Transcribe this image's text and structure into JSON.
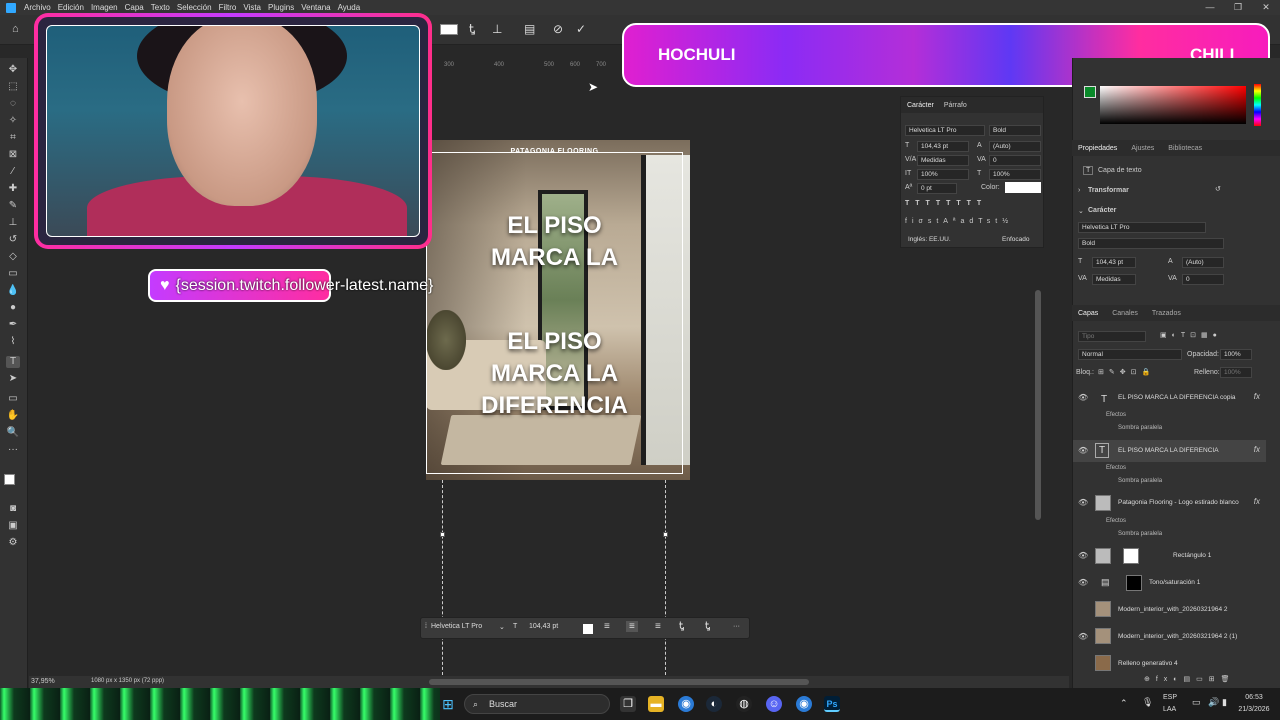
{
  "menubar": {
    "items": [
      "Archivo",
      "Edición",
      "Imagen",
      "Capa",
      "Texto",
      "Selección",
      "Filtro",
      "Vista",
      "Plugins",
      "Ventana",
      "Ayuda"
    ]
  },
  "window_controls": {
    "minimize": "—",
    "restore": "❐",
    "close": "✕"
  },
  "options_bar": {
    "home_icon": "home-icon",
    "cancel_icon": "cancel-icon",
    "commit_icon": "check-icon"
  },
  "ruler": {
    "ticks": [
      "300",
      "400",
      "500",
      "600",
      "700"
    ]
  },
  "banner": {
    "left": "HOCHULI",
    "right": "CHILL"
  },
  "follower": {
    "text": "{session.twitch.follower-latest.name}"
  },
  "document": {
    "brand": "PATAGONIA FLOORING",
    "text1_line1": "EL PISO",
    "text1_line2": "MARCA LA",
    "text2_line1": "EL PISO",
    "text2_line2": "MARCA LA",
    "text2_line3": "DIFERENCIA"
  },
  "character_panel": {
    "tab_character": "Carácter",
    "tab_paragraph": "Párrafo",
    "font_family": "Helvetica LT Pro",
    "font_style": "Bold",
    "font_size": "104,43 pt",
    "leading": "(Auto)",
    "kerning": "Medidas",
    "tracking": "0",
    "vertical_scale": "100%",
    "horizontal_scale": "100%",
    "baseline": "0 pt",
    "color_label": "Color:",
    "language": "Inglés: EE.UU.",
    "antialias": "Enfocado"
  },
  "properties": {
    "tabs": [
      "Propiedades",
      "Ajustes",
      "Bibliotecas"
    ],
    "layer_type": "Capa de texto",
    "transform_label": "Transformar",
    "character_label": "Carácter",
    "font_family": "Helvetica LT Pro",
    "font_style": "Bold",
    "font_size": "104,43 pt",
    "leading": "(Auto)",
    "kerning": "Medidas",
    "tracking": "0"
  },
  "layers_panel": {
    "tabs": [
      "Capas",
      "Canales",
      "Trazados"
    ],
    "search_placeholder": "Tipo",
    "blend_mode": "Normal",
    "opacity_label": "Opacidad:",
    "opacity": "100%",
    "lock_label": "Bloq.:",
    "fill_label": "Relleno:",
    "fill": "100%",
    "layers": [
      {
        "name": "EL PISO MARCA LA DIFERENCIA copia",
        "fx": "fx"
      },
      {
        "name": "EL PISO MARCA LA DIFERENCIA",
        "fx": "fx"
      },
      {
        "name": "Patagonia Flooring - Logo estirado blanco",
        "fx": "fx"
      },
      {
        "name": "Rectángulo 1",
        "fx": ""
      },
      {
        "name": "Tono/saturación 1",
        "fx": ""
      },
      {
        "name": "Modern_interior_with_20260321964 2",
        "fx": ""
      },
      {
        "name": "Modern_interior_with_20260321964 2 (1)",
        "fx": ""
      },
      {
        "name": "Relleno generativo 4",
        "fx": ""
      }
    ],
    "effects_label": "Efectos",
    "shadow_label": "Sombra paralela"
  },
  "floating_bar": {
    "font": "Helvetica LT Pro",
    "size": "104,43 pt",
    "more": "···"
  },
  "status": {
    "zoom": "37,95%",
    "doc_info": "1080 px x 1350 px (72 ppp)"
  },
  "taskbar": {
    "search_label": "Buscar",
    "lang_top": "ESP",
    "lang_bottom": "LAA",
    "time": "06:53",
    "date": "21/3/2026"
  },
  "colors": {
    "accent_pink": "#ff2da0",
    "accent_purple": "#c43bff",
    "ps_blue": "#31a8ff"
  }
}
